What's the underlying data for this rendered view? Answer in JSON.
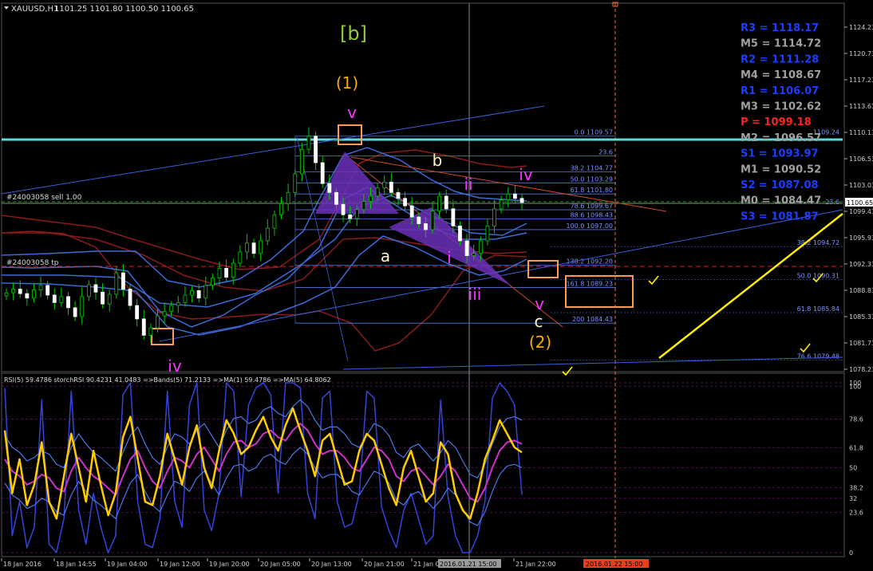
{
  "header": {
    "symbol": "XAUUSD,H1",
    "ohlc": "1101.25 1101.80 1100.50 1100.65"
  },
  "colors": {
    "bull": "#00cc00",
    "bear": "#ffffff",
    "band_blue": "#3a6bd6",
    "band_red": "#8b1a1a",
    "grid": "#2a2a2a",
    "fib": "#5577dd",
    "magenta": "#ff33ff",
    "orange": "#ff9955",
    "gold": "#ffaa00",
    "cyan": "#55dddd",
    "yellow": "#ffee00",
    "rsi_yellow": "#ffcc00",
    "rsi_magenta": "#cc33cc",
    "rsi_blue": "#3344dd",
    "pivot_blue": "#1a3dff",
    "pivot_gray": "#a0a0a0",
    "pivot_red": "#ff2020"
  },
  "price_axis": {
    "ticks": [
      "1124.23",
      "1120.73",
      "1117.23",
      "1113.63",
      "1110.13",
      "1106.53",
      "1103.03",
      "1099.43",
      "1095.93",
      "1092.33",
      "1088.83",
      "1085.33",
      "1081.73",
      "1078.23"
    ],
    "current": "1100.65",
    "marker_1109": "1109.24"
  },
  "time_axis": {
    "labels": [
      "18 Jan 2016",
      "18 Jan 14:55",
      "19 Jan 04:00",
      "19 Jan 12:00",
      "19 Jan 20:00",
      "20 Jan 05:00",
      "20 Jan 13:00",
      "20 Jan 21:00",
      "21 Jan 0",
      "21 Jan 22:00"
    ],
    "highlight": "2016.01.21 15:00",
    "future_marker": "2016.01.22 15:00"
  },
  "fib_levels": [
    {
      "label": "0.0 1109.57",
      "price": 1109.57
    },
    {
      "label": "23.6",
      "price": 1106.9
    },
    {
      "label": "38.2 1104.77",
      "price": 1104.77
    },
    {
      "label": "50.0 1103.29",
      "price": 1103.29
    },
    {
      "label": "61.8 1101.80",
      "price": 1101.8
    },
    {
      "label": "78.6 1099.67",
      "price": 1099.67
    },
    {
      "label": "88.6 1098.43",
      "price": 1098.43
    },
    {
      "label": "100.0 1097.00",
      "price": 1097.0
    },
    {
      "label": "138.2 1092.20",
      "price": 1092.2
    },
    {
      "label": "161.8 1089.23",
      "price": 1089.23
    },
    {
      "label": "200 1084.43",
      "price": 1084.43
    }
  ],
  "fib_right": [
    {
      "label": "38.2 1094.72",
      "price": 1094.72
    },
    {
      "label": "50.0 1090.31",
      "price": 1090.31
    },
    {
      "label": "61.8 1085.84",
      "price": 1085.84
    },
    {
      "label": "76.6 1079.48",
      "price": 1079.48
    }
  ],
  "fib_right_extra": "1109.24",
  "fib_right_extra2": "23.6",
  "trade_lines": {
    "sell": "#24003058 sell 1.00",
    "tp": "#24003058 tp"
  },
  "pivots": [
    {
      "label": "R3 = 1118.17",
      "tone": "blue"
    },
    {
      "label": "M5 = 1114.72",
      "tone": "gray"
    },
    {
      "label": "R2 = 1111.28",
      "tone": "blue"
    },
    {
      "label": "M4 = 1108.67",
      "tone": "gray"
    },
    {
      "label": "R1 = 1106.07",
      "tone": "blue"
    },
    {
      "label": "M3 = 1102.62",
      "tone": "gray"
    },
    {
      "label": "P  = 1099.18",
      "tone": "red"
    },
    {
      "label": "M2 = 1096.57",
      "tone": "gray"
    },
    {
      "label": "S1 = 1093.97",
      "tone": "blue"
    },
    {
      "label": "M1 = 1090.52",
      "tone": "gray"
    },
    {
      "label": "S2 = 1087.08",
      "tone": "blue"
    },
    {
      "label": "M0 = 1084.47",
      "tone": "gray"
    },
    {
      "label": "S3 = 1081.87",
      "tone": "blue"
    }
  ],
  "wave_labels": {
    "b_bracket": "[b]",
    "one": "(1)",
    "v_top": "v",
    "b": "b",
    "a": "a",
    "iv_bottom": "iv",
    "ii": "ii",
    "iv": "iv",
    "i": "i",
    "iii": "iii",
    "v_low": "v",
    "c": "c",
    "two": "(2)"
  },
  "rsi": {
    "header": "RSI(5) 59.4786   storchRSI 90.4231 41.0483   =>Bands(5) 71.2133   =>MA(1) 59.4786   =>MA(5) 64.8062",
    "ticks": [
      "100",
      "100",
      "78.6",
      "61.8",
      "50",
      "38.2",
      "32",
      "23.6",
      "0"
    ]
  },
  "chart_data": {
    "type": "line",
    "title": "",
    "price_range": [
      1078.23,
      1124.23
    ],
    "rsi_range": [
      0,
      100
    ],
    "price_path": [
      1088.5,
      1089.0,
      1088.4,
      1087.8,
      1088.9,
      1089.5,
      1088.2,
      1087.2,
      1088.0,
      1086.5,
      1085.3,
      1088.0,
      1089.6,
      1088.6,
      1087.0,
      1088.3,
      1091.2,
      1089.0,
      1086.8,
      1085.0,
      1082.8,
      1083.8,
      1085.4,
      1086.0,
      1086.8,
      1087.2,
      1088.2,
      1088.8,
      1087.8,
      1089.5,
      1090.5,
      1091.8,
      1090.6,
      1092.5,
      1094.0,
      1095.2,
      1093.8,
      1095.5,
      1097.2,
      1099.0,
      1100.5,
      1102.0,
      1104.5,
      1107.8,
      1109.57,
      1106.0,
      1103.2,
      1102.0,
      1100.4,
      1099.0,
      1098.5,
      1099.7,
      1100.8,
      1101.5,
      1102.6,
      1103.4,
      1102.0,
      1101.2,
      1100.2,
      1098.7,
      1097.8,
      1097.0,
      1099.5,
      1101.5,
      1099.8,
      1097.5,
      1095.5,
      1093.5,
      1093.8,
      1095.5,
      1097.5,
      1099.8,
      1101.0,
      1101.8,
      1101.2,
      1100.65
    ],
    "rsi_series": [
      {
        "name": "RSI(5)",
        "values": [
          72,
          35,
          55,
          28,
          40,
          65,
          30,
          20,
          45,
          70,
          50,
          30,
          60,
          40,
          22,
          35,
          68,
          80,
          55,
          30,
          28,
          45,
          70,
          55,
          40,
          62,
          75,
          50,
          38,
          60,
          78,
          70,
          58,
          62,
          72,
          80,
          68,
          60,
          75,
          85,
          72,
          60,
          45,
          66,
          70,
          55,
          40,
          42,
          60,
          70,
          66,
          52,
          38,
          28,
          50,
          60,
          45,
          30,
          35,
          65,
          58,
          35,
          25,
          20,
          35,
          55,
          66,
          78,
          70,
          62,
          59
        ]
      },
      {
        "name": "MA(5)",
        "values": [
          55,
          48,
          45,
          40,
          42,
          46,
          44,
          38,
          36,
          48,
          56,
          50,
          45,
          42,
          38,
          34,
          45,
          55,
          60,
          50,
          42,
          38,
          48,
          56,
          54,
          50,
          58,
          62,
          55,
          48,
          58,
          65,
          66,
          62,
          64,
          70,
          72,
          68,
          66,
          72,
          76,
          72,
          64,
          58,
          60,
          60,
          56,
          50,
          48,
          55,
          62,
          60,
          55,
          45,
          42,
          48,
          50,
          45,
          40,
          45,
          52,
          48,
          40,
          32,
          30,
          38,
          50,
          60,
          65,
          66,
          64
        ]
      }
    ]
  }
}
